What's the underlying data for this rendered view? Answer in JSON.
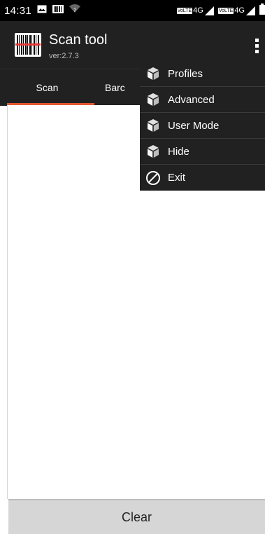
{
  "status_bar": {
    "time": "14:31",
    "icons": [
      "image-icon",
      "barcode-icon",
      "wifi-question-icon"
    ],
    "right": {
      "volte1": "VoLTE",
      "net1": "4G",
      "volte2": "VoLTE",
      "net2": "4G"
    }
  },
  "app": {
    "title": "Scan tool",
    "version": "ver:2.7.3",
    "logo_icon": "barcode-scanner-icon",
    "overflow_icon": "more-vert-icon"
  },
  "tabs": [
    {
      "label": "Scan",
      "selected": true
    },
    {
      "label": "Barc",
      "selected": false
    }
  ],
  "menu": {
    "items": [
      {
        "label": "Profiles",
        "icon": "cube-icon"
      },
      {
        "label": "Advanced",
        "icon": "cube-icon"
      },
      {
        "label": "User Mode",
        "icon": "cube-icon"
      },
      {
        "label": "Hide",
        "icon": "cube-icon"
      },
      {
        "label": "Exit",
        "icon": "block-icon"
      }
    ]
  },
  "clear_button": {
    "label": "Clear"
  },
  "colors": {
    "appbar": "#212121",
    "tab_indicator": "#e4572e",
    "clear_bg": "#d6d6d6"
  }
}
